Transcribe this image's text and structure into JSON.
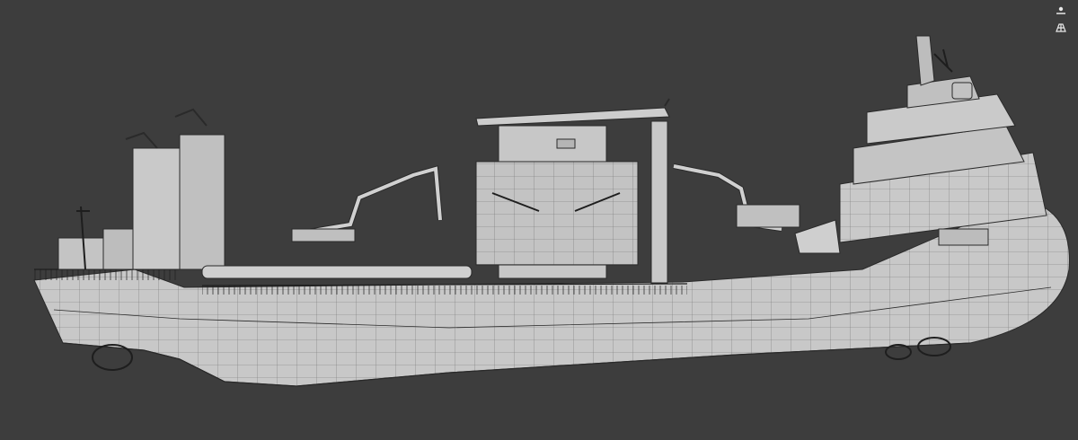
{
  "viewport": {
    "background": "#3d3d3d",
    "model_fill": "#c9c9c9",
    "model_shade": "#b3b3b3",
    "wire_color": "#2a2a2a"
  },
  "gizmo": {
    "icons": [
      "camera-lock-icon",
      "grid-toggle-icon"
    ]
  }
}
